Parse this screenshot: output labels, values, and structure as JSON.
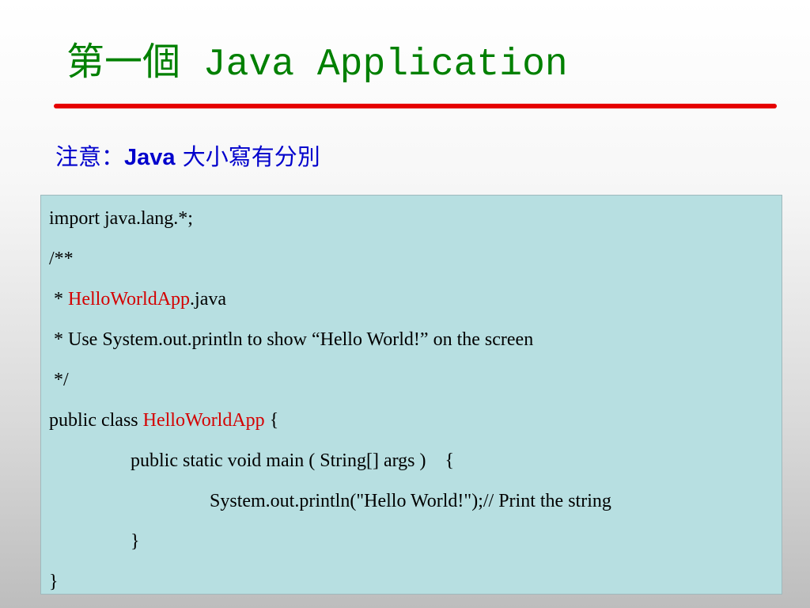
{
  "colors": {
    "title": "#008000",
    "rule": "#e60000",
    "note": "#0000cc",
    "code_background": "#b7dfe1",
    "highlight": "#d40000"
  },
  "title": "第一個 Java Application",
  "note": {
    "prefix": "注意：",
    "keyword": "Java",
    "suffix": " 大小寫有分別"
  },
  "code": {
    "line1": "import java.lang.*;",
    "line2": "/**",
    "line3_prefix": " * ",
    "line3_class": "HelloWorldApp",
    "line3_suffix": ".java",
    "line4": " * Use System.out.println to show “Hello World!” on the screen",
    "line5": " */",
    "line6_prefix": "public class ",
    "line6_class": "HelloWorldApp",
    "line6_suffix": " {",
    "line7": "public static void main ( String[] args )    {",
    "line8": "System.out.println(\"Hello World!\");// Print the string",
    "line9": "}",
    "line10": "}"
  }
}
